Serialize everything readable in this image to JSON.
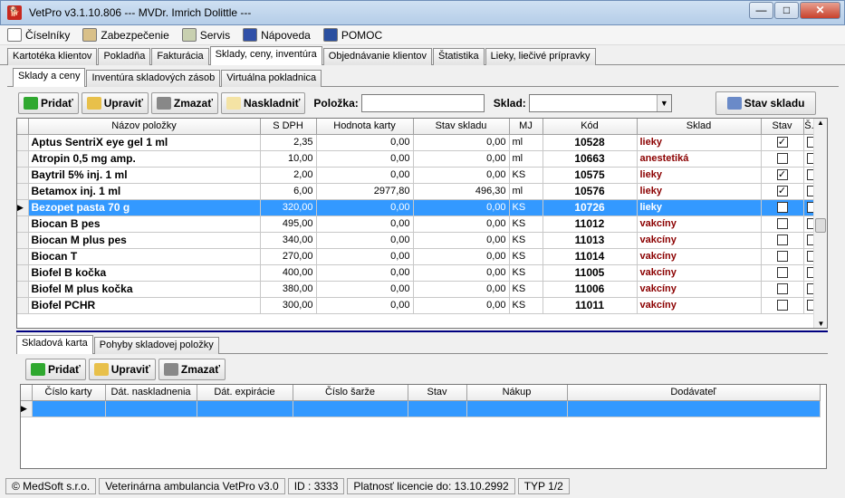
{
  "window": {
    "title": "VetPro v3.1.10.806 --- MVDr. Imrich Dolittle ---",
    "minimize": "—",
    "maximize": "□",
    "close": "✕"
  },
  "menu": [
    {
      "label": "Číselníky",
      "icon": "document-icon"
    },
    {
      "label": "Zabezpečenie",
      "icon": "lock-icon"
    },
    {
      "label": "Servis",
      "icon": "service-icon"
    },
    {
      "label": "Nápoveda",
      "icon": "help-book-icon"
    },
    {
      "label": "POMOC",
      "icon": "monitor-icon"
    }
  ],
  "main_tabs": [
    "Kartotéka klientov",
    "Pokladňa",
    "Fakturácia",
    "Sklady, ceny, inventúra",
    "Objednávanie klientov",
    "Štatistika",
    "Lieky, liečivé prípravky"
  ],
  "sub_tabs": [
    "Sklady a ceny",
    "Inventúra skladových zásob",
    "Virtuálna pokladnica"
  ],
  "toolbar": {
    "add": "Pridať",
    "edit": "Upraviť",
    "delete": "Zmazať",
    "stock_in": "Naskladniť",
    "item_label": "Položka:",
    "item_value": "",
    "warehouse_label": "Sklad:",
    "warehouse_value": "",
    "stock_status": "Stav skladu"
  },
  "grid": {
    "columns": [
      "Názov položky",
      "S DPH",
      "Hodnota karty",
      "Stav skladu",
      "MJ",
      "Kód",
      "Sklad",
      "Stav",
      "Š..."
    ],
    "rows": [
      {
        "name": "Aptus SentriX eye gel 1 ml",
        "price": "2,35",
        "card_value": "0,00",
        "stock": "0,00",
        "unit": "ml",
        "code": "10528",
        "warehouse": "lieky",
        "status": true,
        "s": false
      },
      {
        "name": "Atropin 0,5 mg amp.",
        "price": "10,00",
        "card_value": "0,00",
        "stock": "0,00",
        "unit": "ml",
        "code": "10663",
        "warehouse": "anestetiká",
        "status": false,
        "s": false
      },
      {
        "name": "Baytril 5% inj. 1 ml",
        "price": "2,00",
        "card_value": "0,00",
        "stock": "0,00",
        "unit": "KS",
        "code": "10575",
        "warehouse": "lieky",
        "status": true,
        "s": false
      },
      {
        "name": "Betamox inj. 1 ml",
        "price": "6,00",
        "card_value": "2977,80",
        "stock": "496,30",
        "unit": "ml",
        "code": "10576",
        "warehouse": "lieky",
        "status": true,
        "s": false
      },
      {
        "name": "Bezopet pasta 70 g",
        "price": "320,00",
        "card_value": "0,00",
        "stock": "0,00",
        "unit": "KS",
        "code": "10726",
        "warehouse": "lieky",
        "status": true,
        "s": false,
        "selected": true
      },
      {
        "name": "Biocan B pes",
        "price": "495,00",
        "card_value": "0,00",
        "stock": "0,00",
        "unit": "KS",
        "code": "11012",
        "warehouse": "vakcíny",
        "status": false,
        "s": false
      },
      {
        "name": "Biocan M plus pes",
        "price": "340,00",
        "card_value": "0,00",
        "stock": "0,00",
        "unit": "KS",
        "code": "11013",
        "warehouse": "vakcíny",
        "status": false,
        "s": false
      },
      {
        "name": "Biocan T",
        "price": "270,00",
        "card_value": "0,00",
        "stock": "0,00",
        "unit": "KS",
        "code": "11014",
        "warehouse": "vakcíny",
        "status": false,
        "s": false
      },
      {
        "name": "Biofel B kočka",
        "price": "400,00",
        "card_value": "0,00",
        "stock": "0,00",
        "unit": "KS",
        "code": "11005",
        "warehouse": "vakcíny",
        "status": false,
        "s": false
      },
      {
        "name": "Biofel M plus kočka",
        "price": "380,00",
        "card_value": "0,00",
        "stock": "0,00",
        "unit": "KS",
        "code": "11006",
        "warehouse": "vakcíny",
        "status": false,
        "s": false
      },
      {
        "name": "Biofel PCHR",
        "price": "300,00",
        "card_value": "0,00",
        "stock": "0,00",
        "unit": "KS",
        "code": "11011",
        "warehouse": "vakcíny",
        "status": false,
        "s": false
      }
    ]
  },
  "bottom_tabs": [
    "Skladová karta",
    "Pohyby skladovej položky"
  ],
  "bottom_toolbar": {
    "add": "Pridať",
    "edit": "Upraviť",
    "delete": "Zmazať"
  },
  "bottom_grid": {
    "columns": [
      "Číslo karty",
      "Dát. naskladnenia",
      "Dát. expirácie",
      "Číslo šarže",
      "Stav",
      "Nákup",
      "Dodávateľ"
    ]
  },
  "status": [
    "© MedSoft s.r.o.",
    "Veterinárna ambulancia VetPro v3.0",
    "ID : 3333",
    "Platnosť licencie do: 13.10.2992",
    "TYP 1/2"
  ],
  "colors": {
    "selection": "#3399ff",
    "warehouse_text": "#8b0000",
    "divider": "#000080"
  }
}
